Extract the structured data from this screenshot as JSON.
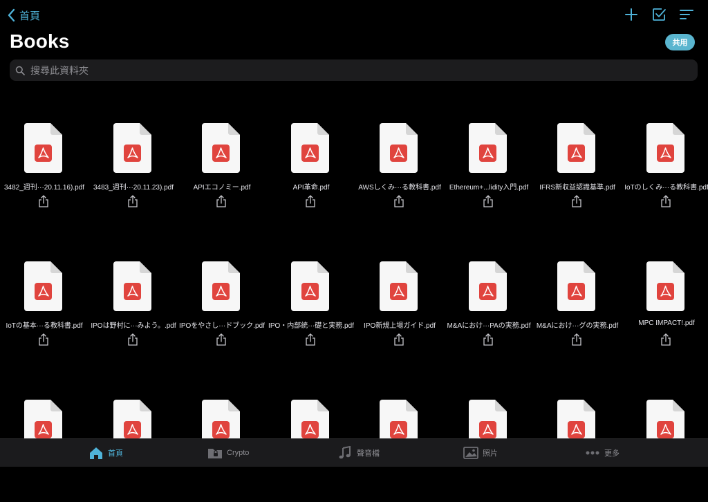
{
  "nav": {
    "back_label": "首頁"
  },
  "toolbar": {
    "icons": [
      "plus-icon",
      "select-check-icon",
      "sort-lines-icon"
    ]
  },
  "page": {
    "title": "Books",
    "share_label": "共用"
  },
  "search": {
    "placeholder": "搜尋此資料夾"
  },
  "files": [
    {
      "name": "3482_週刊···20.11.16).pdf"
    },
    {
      "name": "3483_週刊···20.11.23).pdf"
    },
    {
      "name": "APIエコノミー.pdf"
    },
    {
      "name": "API革命.pdf"
    },
    {
      "name": "AWSしくみ···る教科書.pdf"
    },
    {
      "name": "Ethereum+...lidity入門.pdf"
    },
    {
      "name": "IFRS新収益認識基準.pdf"
    },
    {
      "name": "IoTのしくみ···る教科書.pdf"
    },
    {
      "name": "IoTの基本···る教科書.pdf"
    },
    {
      "name": "IPOは野村に···みよう。.pdf"
    },
    {
      "name": "IPOをやさし···ドブック.pdf"
    },
    {
      "name": "IPO・内部統···礎と実務.pdf"
    },
    {
      "name": "IPO新規上場ガイド.pdf"
    },
    {
      "name": "M&Aにおけ···PAの実務.pdf"
    },
    {
      "name": "M&Aにおけ···グの実務.pdf"
    },
    {
      "name": "MPC IMPACT!.pdf"
    },
    {
      "name": ""
    },
    {
      "name": ""
    },
    {
      "name": ""
    },
    {
      "name": ""
    },
    {
      "name": ""
    },
    {
      "name": ""
    },
    {
      "name": ""
    },
    {
      "name": ""
    }
  ],
  "tabs": [
    {
      "label": "首頁",
      "icon": "home-icon",
      "active": true
    },
    {
      "label": "Crypto",
      "icon": "folder-lock-icon",
      "active": false
    },
    {
      "label": "聲音檔",
      "icon": "music-note-icon",
      "active": false
    },
    {
      "label": "照片",
      "icon": "photo-icon",
      "active": false
    },
    {
      "label": "更多",
      "icon": "more-dots-icon",
      "active": false
    }
  ],
  "colors": {
    "accent": "#4fb3d9",
    "pdf_red": "#e0443e",
    "background": "#000000"
  }
}
